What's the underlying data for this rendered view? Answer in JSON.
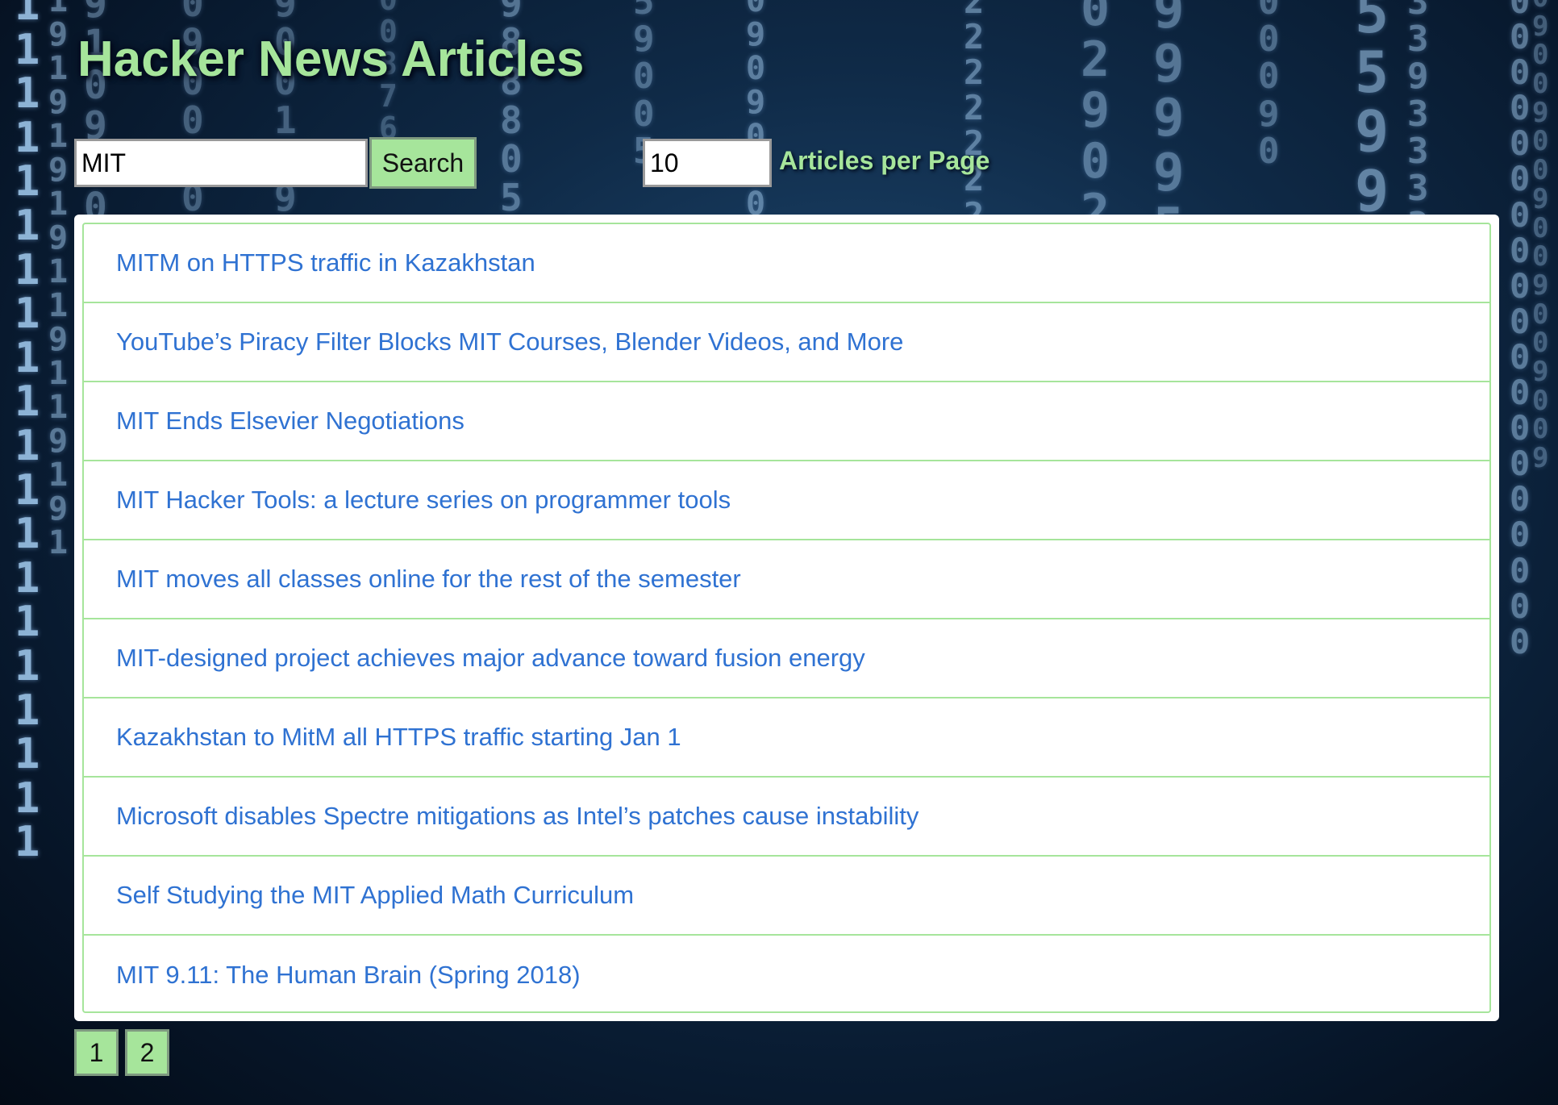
{
  "header": {
    "title": "Hacker News Articles"
  },
  "search": {
    "value": "MIT",
    "button_label": "Search"
  },
  "per_page": {
    "value": "10",
    "label": "Articles per Page"
  },
  "articles": [
    {
      "title": "MITM on HTTPS traffic in Kazakhstan"
    },
    {
      "title": "YouTube’s Piracy Filter Blocks MIT Courses, Blender Videos, and More"
    },
    {
      "title": "MIT Ends Elsevier Negotiations"
    },
    {
      "title": "MIT Hacker Tools: a lecture series on programmer tools"
    },
    {
      "title": "MIT moves all classes online for the rest of the semester"
    },
    {
      "title": "MIT-designed project achieves major advance toward fusion energy"
    },
    {
      "title": "Kazakhstan to MitM all HTTPS traffic starting Jan 1"
    },
    {
      "title": "Microsoft disables Spectre mitigations as Intel’s patches cause instability"
    },
    {
      "title": "Self Studying the MIT Applied Math Curriculum"
    },
    {
      "title": "MIT 9.11: The Human Brain (Spring 2018)"
    }
  ],
  "pagination": {
    "pages": [
      "1",
      "2"
    ]
  },
  "colors": {
    "accent_green": "#a6e59b",
    "link_blue": "#2f72d2",
    "background": "#0f2a47"
  },
  "background_image": "matrix-digital-rain-background"
}
